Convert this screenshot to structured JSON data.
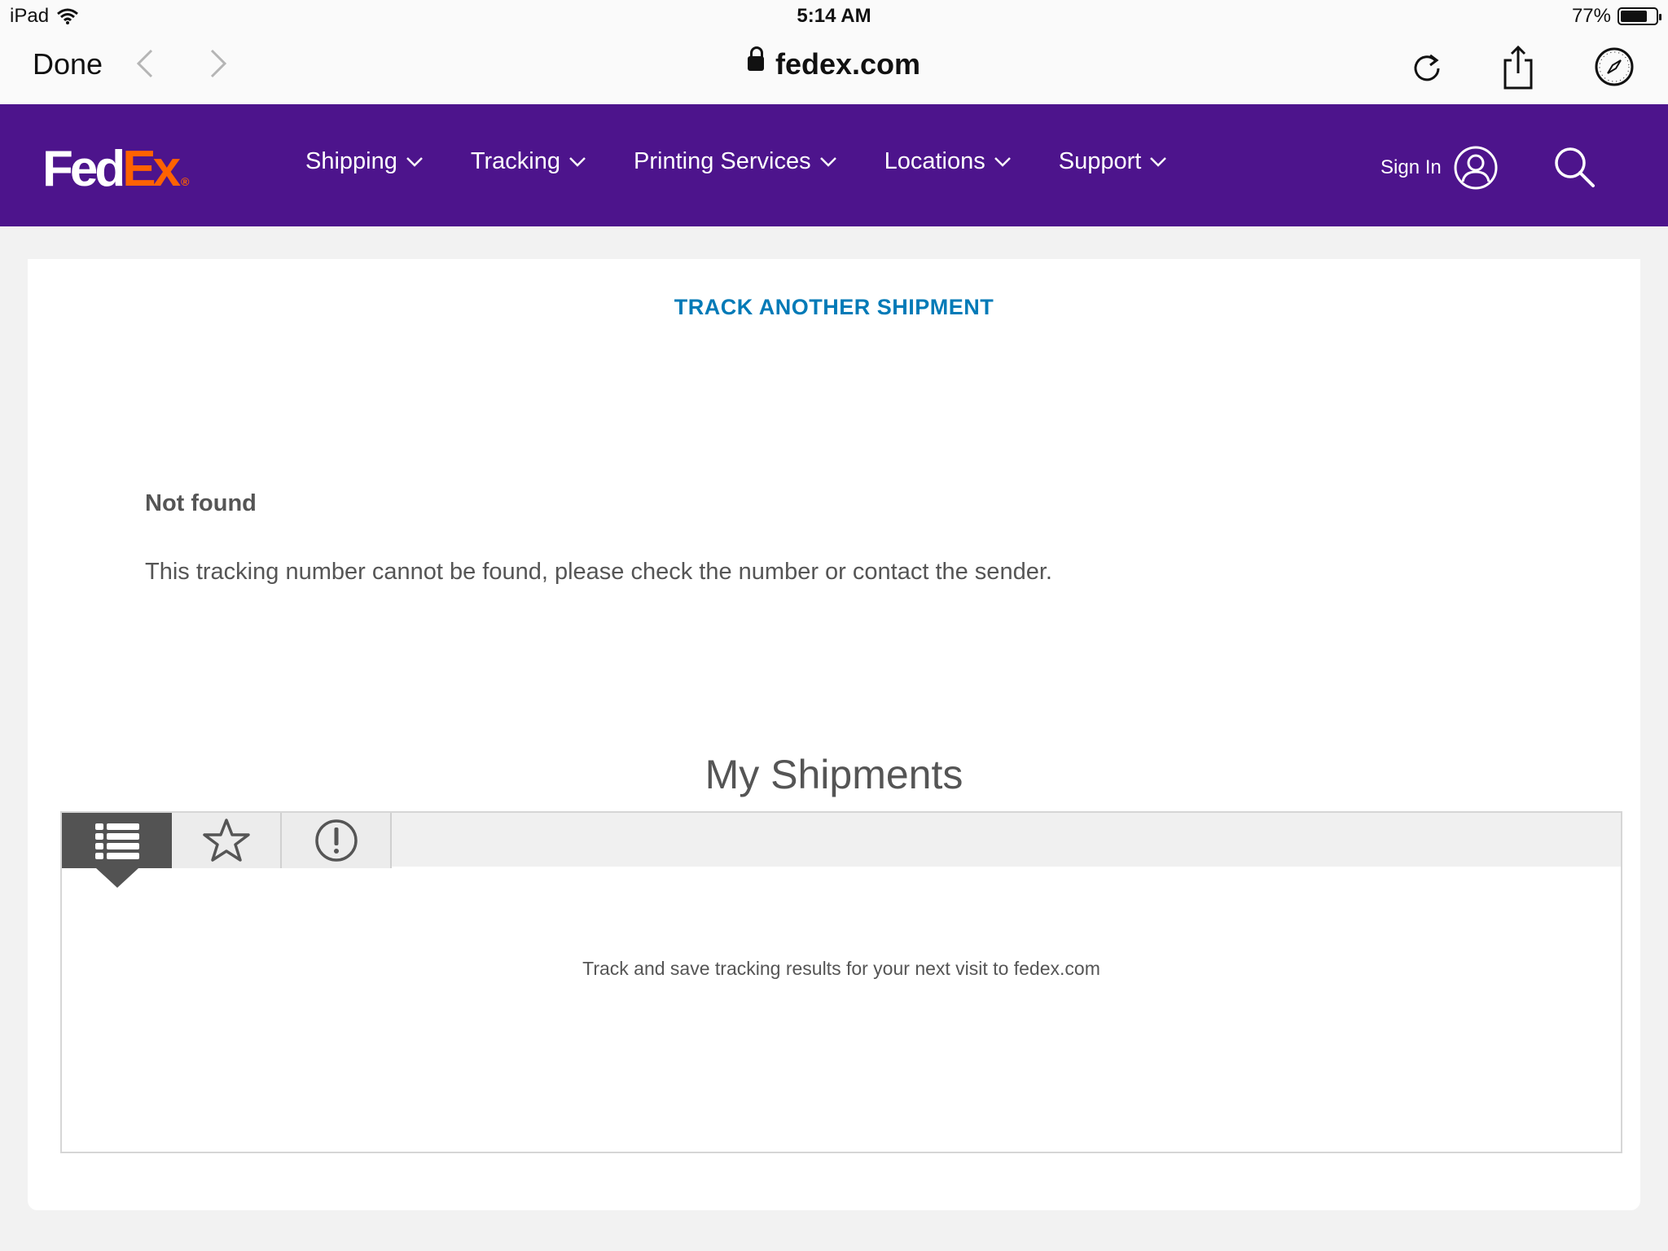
{
  "status_bar": {
    "device": "iPad",
    "time": "5:14 AM",
    "battery": "77%",
    "battery_level": 0.77
  },
  "browser": {
    "done_label": "Done",
    "url": "fedex.com",
    "icons": [
      "chevron-left-icon",
      "chevron-right-icon",
      "lock-icon",
      "reload-icon",
      "share-icon",
      "compass-icon"
    ]
  },
  "header": {
    "logo": "FedEx",
    "logo_colors": {
      "fed": "#ffffff",
      "ex": "#ff6200"
    },
    "nav": [
      {
        "label": "Shipping"
      },
      {
        "label": "Tracking"
      },
      {
        "label": "Printing Services"
      },
      {
        "label": "Locations"
      },
      {
        "label": "Support"
      }
    ],
    "sign_in": "Sign In",
    "background": "#4d148c"
  },
  "main": {
    "track_another": "TRACK ANOTHER SHIPMENT",
    "error_title": "Not found",
    "error_message": "This tracking number cannot be found, please check the number or contact the sender.",
    "shipments_title": "My Shipments",
    "tabs": [
      {
        "icon": "list-icon",
        "active": true
      },
      {
        "icon": "star-icon",
        "active": false
      },
      {
        "icon": "alert-icon",
        "active": false
      }
    ],
    "empty_message": "Track and save tracking results for your next visit to fedex.com",
    "link_color": "#007ab7"
  }
}
